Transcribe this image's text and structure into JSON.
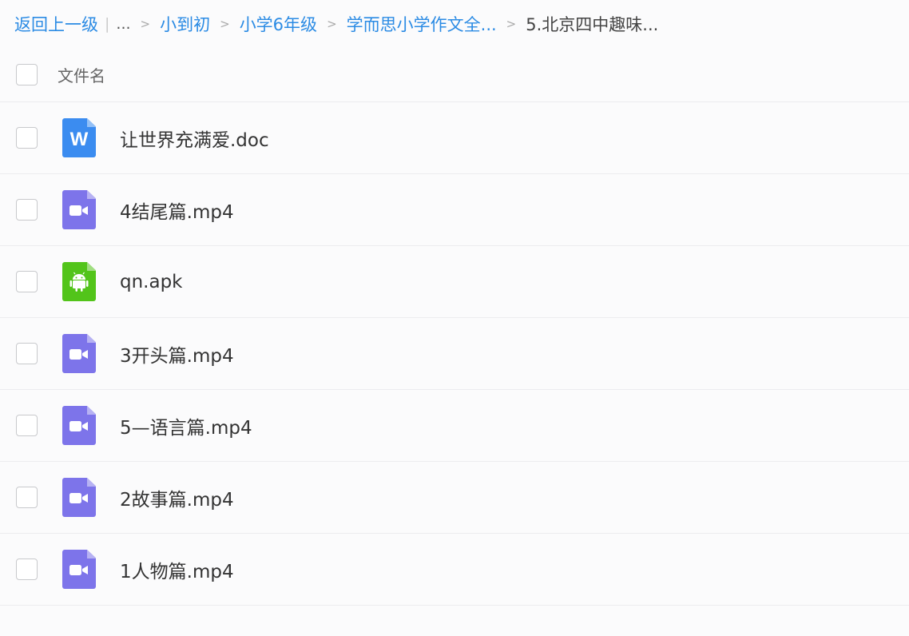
{
  "breadcrumb": {
    "back_label": "返回上一级",
    "ellipsis": "...",
    "items": [
      "小到初",
      "小学6年级",
      "学而思小学作文全..."
    ],
    "current": "5.北京四中趣味..."
  },
  "list_header": {
    "column_label": "文件名"
  },
  "files": [
    {
      "name": "让世界充满爱.doc",
      "type": "doc",
      "icon": "word-doc-icon",
      "color": "#3b8cf0"
    },
    {
      "name": "4结尾篇.mp4",
      "type": "video",
      "icon": "video-file-icon",
      "color": "#7d74ea"
    },
    {
      "name": "qn.apk",
      "type": "apk",
      "icon": "android-apk-icon",
      "color": "#52c41a"
    },
    {
      "name": "3开头篇.mp4",
      "type": "video",
      "icon": "video-file-icon",
      "color": "#7d74ea"
    },
    {
      "name": "5—语言篇.mp4",
      "type": "video",
      "icon": "video-file-icon",
      "color": "#7d74ea"
    },
    {
      "name": "2故事篇.mp4",
      "type": "video",
      "icon": "video-file-icon",
      "color": "#7d74ea"
    },
    {
      "name": "1人物篇.mp4",
      "type": "video",
      "icon": "video-file-icon",
      "color": "#7d74ea"
    }
  ],
  "doc_icon_letter": "W"
}
